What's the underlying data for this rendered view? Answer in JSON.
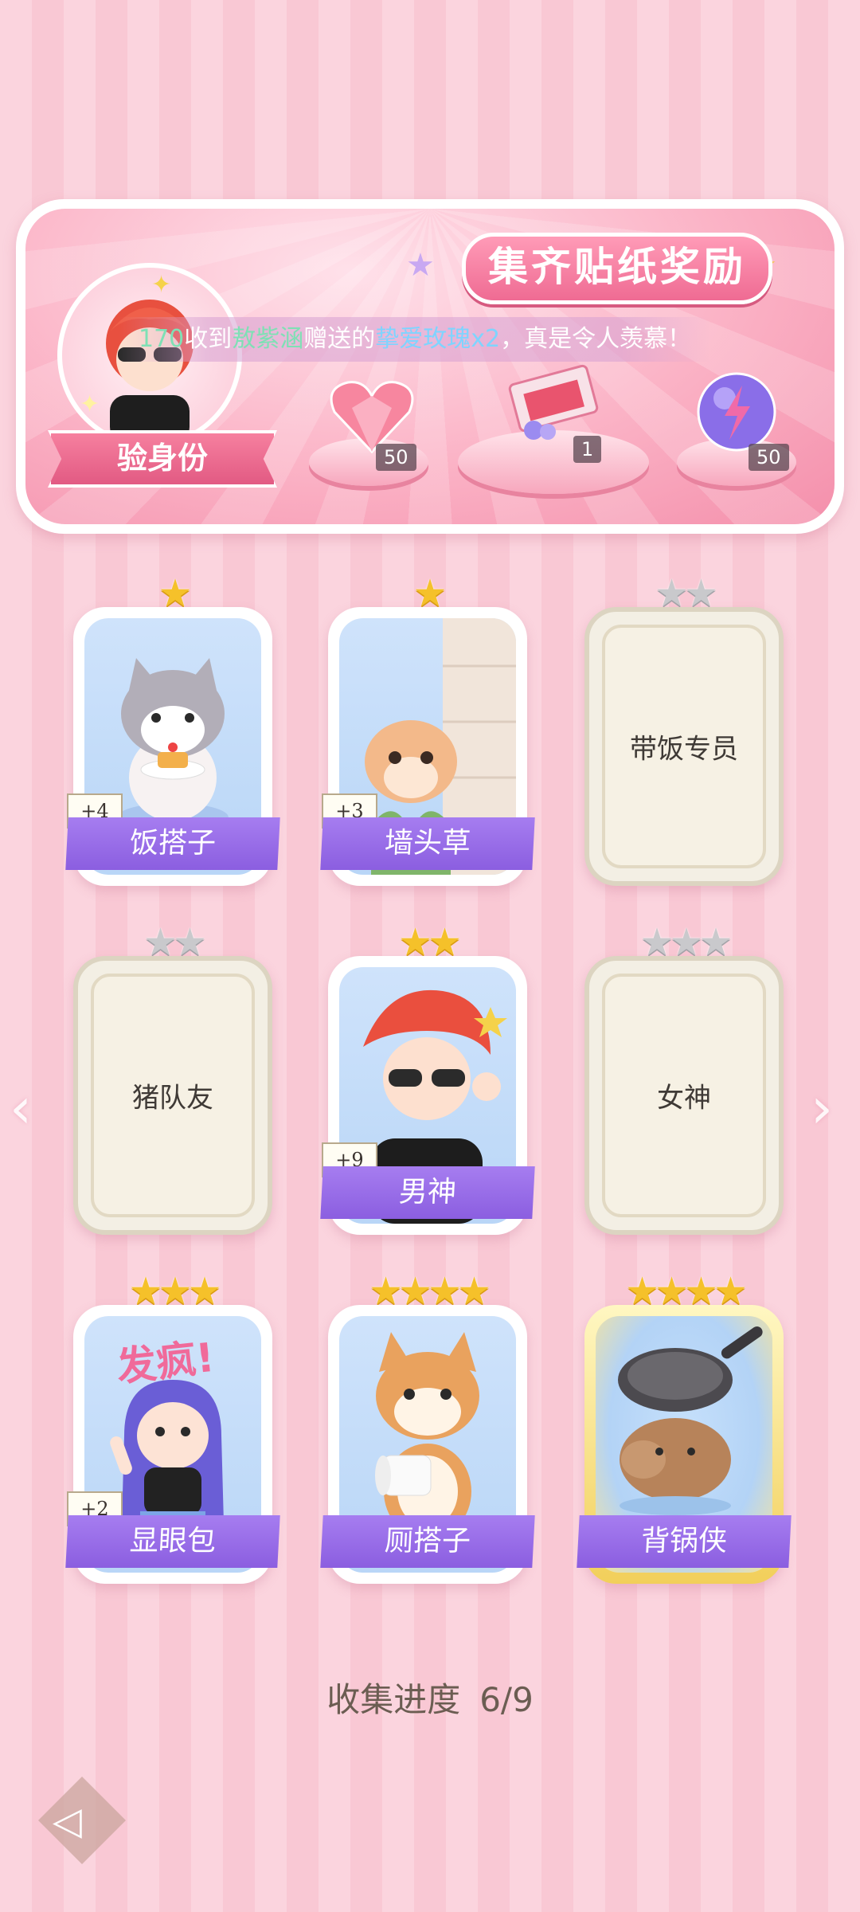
{
  "banner": {
    "title": "集齐贴纸奖励",
    "verify_label": "验身份",
    "ticker": {
      "uid": "170",
      "text1": "收到",
      "sender": "敖紫涵",
      "text2": "赠送的",
      "gift": "挚爱玫瑰x2",
      "text3": "，真是令人羡慕！"
    },
    "rewards": [
      {
        "icon": "heart-gem-icon",
        "count": "50"
      },
      {
        "icon": "gift-box-icon",
        "count": "1"
      },
      {
        "icon": "energy-orb-icon",
        "count": "50"
      }
    ]
  },
  "cards": [
    {
      "name": "饭搭子",
      "stars": 1,
      "plus": "+4",
      "unlocked": true,
      "art": "cat-with-cake"
    },
    {
      "name": "墙头草",
      "stars": 1,
      "plus": "+3",
      "unlocked": true,
      "art": "hamster-behind-wall"
    },
    {
      "name": "带饭专员",
      "stars": 2,
      "plus": "",
      "unlocked": false
    },
    {
      "name": "猪队友",
      "stars": 2,
      "plus": "",
      "unlocked": false
    },
    {
      "name": "男神",
      "stars": 2,
      "plus": "+9",
      "unlocked": true,
      "art": "boy-with-sunglasses"
    },
    {
      "name": "女神",
      "stars": 3,
      "plus": "",
      "unlocked": false
    },
    {
      "name": "显眼包",
      "stars": 3,
      "plus": "+2",
      "unlocked": true,
      "art": "girl-fafeng",
      "art_text": "发疯!"
    },
    {
      "name": "厕搭子",
      "stars": 4,
      "plus": "",
      "unlocked": true,
      "art": "shiba-with-toilet-paper"
    },
    {
      "name": "背锅侠",
      "stars": 4,
      "plus": "",
      "unlocked": true,
      "gold": true,
      "art": "capybara-with-pan"
    }
  ],
  "progress": {
    "label": "收集进度",
    "value": "6/9"
  },
  "colors": {
    "accent": "#ef6b93",
    "name_bar": "#8b5ee0",
    "star_gold": "#f5c12a"
  }
}
